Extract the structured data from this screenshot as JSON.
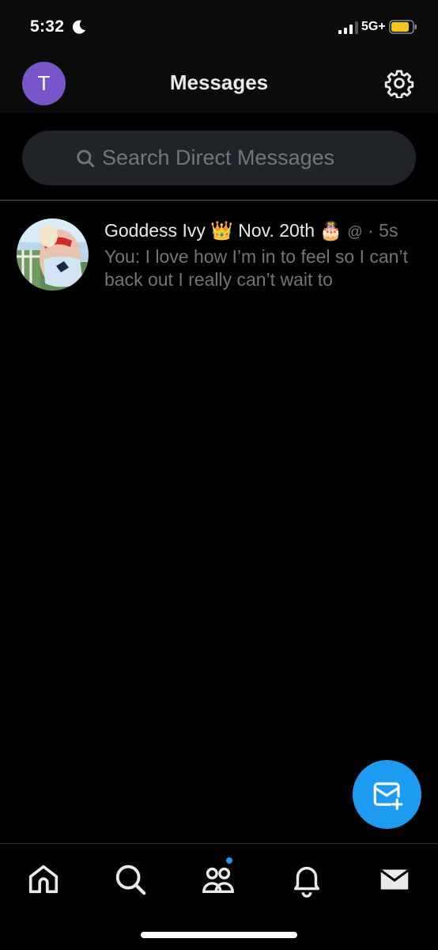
{
  "status_bar": {
    "time": "5:32",
    "network": "5G+",
    "moon_icon": "moon-icon",
    "battery_color": "#f5c518"
  },
  "header": {
    "avatar_initial": "T",
    "avatar_color": "#7856c9",
    "title": "Messages",
    "settings_icon": "gear-icon"
  },
  "search": {
    "placeholder": "Search Direct Messages",
    "icon": "search-icon"
  },
  "conversations": [
    {
      "name": "Goddess Ivy",
      "name_suffix": " 👑 Nov. 20th 🎂 ",
      "handle": "@",
      "separator": " · ",
      "time_ago": "5s",
      "preview": "You: I love how I’m in to feel so I can’t back out I really can’t wait to"
    }
  ],
  "fab": {
    "icon": "new-message-icon",
    "color": "#1d9bf0"
  },
  "tab_bar": {
    "items": [
      "home-icon",
      "search-icon",
      "communities-icon",
      "notifications-icon",
      "messages-icon"
    ],
    "communities_has_dot": true
  }
}
